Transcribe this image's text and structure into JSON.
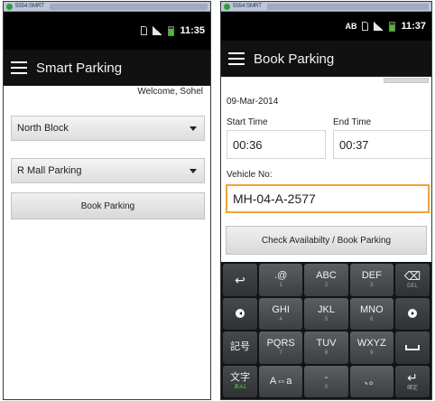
{
  "window": {
    "caption": "5554:SMRT"
  },
  "left_screen": {
    "status": {
      "time": "11:35"
    },
    "app_bar": {
      "title": "Smart Parking"
    },
    "welcome": "Welcome, Sohel",
    "block_select": {
      "value": "North Block"
    },
    "parking_select": {
      "value": "R Mall Parking"
    },
    "book_button": "Book Parking"
  },
  "right_screen": {
    "status": {
      "time": "11:37",
      "ab": "AB"
    },
    "app_bar": {
      "title": "Book Parking"
    },
    "date": "09-Mar-2014",
    "start": {
      "label": "Start Time",
      "value": "00:36"
    },
    "end": {
      "label": "End Time",
      "value": "00:37"
    },
    "vehicle": {
      "label": "Vehicle No:",
      "value": "MH-04-A-2577"
    },
    "check_button": "Check Availabilty / Book Parking",
    "keyboard": {
      "row1": {
        "dot": ".@",
        "dot_num": "1",
        "abc": "ABC",
        "abc_num": "2",
        "def": "DEF",
        "def_num": "3",
        "del_sub": "DEL"
      },
      "row2": {
        "ghi": "GHI",
        "ghi_num": "4",
        "jkl": "JKL",
        "jkl_num": "5",
        "mno": "MNO",
        "mno_num": "6"
      },
      "row3": {
        "kigo": "記号",
        "pqrs": "PQRS",
        "pqrs_num": "7",
        "tuv": "TUV",
        "tuv_num": "8",
        "wxyz": "WXYZ",
        "wxyz_num": "9"
      },
      "row4": {
        "moji": "文字",
        "moji_sub": "あA1",
        "case": "A⇔a",
        "dash": "-",
        "dash_num": "0",
        "punct": "、。",
        "enter_sub": "確定"
      }
    }
  }
}
